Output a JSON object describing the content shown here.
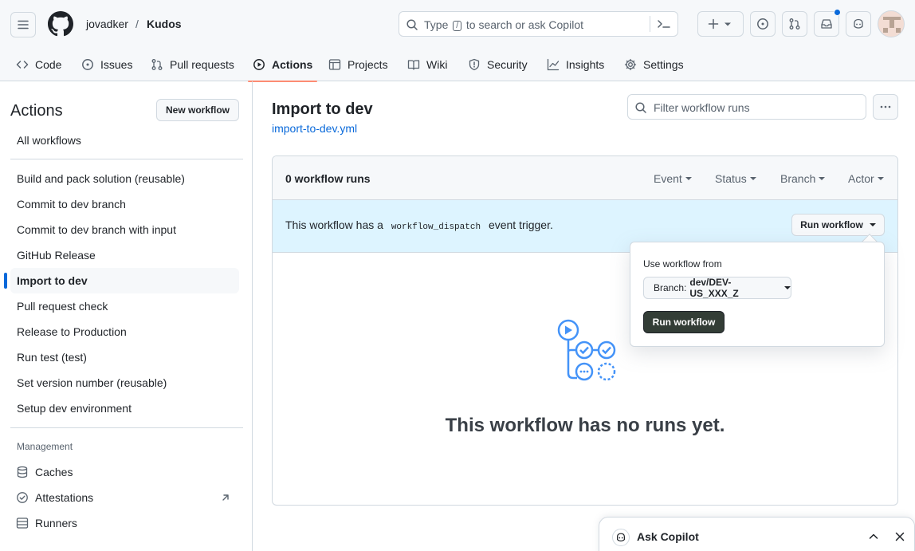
{
  "header": {
    "owner": "jovadker",
    "separator": "/",
    "repo": "Kudos",
    "search": {
      "prefix": "Type",
      "key": "/",
      "suffix": "to search or ask Copilot"
    },
    "plus_label": "+"
  },
  "tabs": [
    {
      "label": "Code",
      "icon": "code-icon"
    },
    {
      "label": "Issues",
      "icon": "issue-opened-icon"
    },
    {
      "label": "Pull requests",
      "icon": "git-pull-request-icon"
    },
    {
      "label": "Actions",
      "icon": "play-icon",
      "selected": true
    },
    {
      "label": "Projects",
      "icon": "table-icon"
    },
    {
      "label": "Wiki",
      "icon": "book-icon"
    },
    {
      "label": "Security",
      "icon": "shield-icon"
    },
    {
      "label": "Insights",
      "icon": "graph-icon"
    },
    {
      "label": "Settings",
      "icon": "gear-icon"
    }
  ],
  "sidebar": {
    "title": "Actions",
    "new_workflow": "New workflow",
    "all_workflows": "All workflows",
    "workflows": [
      "Build and pack solution (reusable)",
      "Commit to dev branch",
      "Commit to dev branch with input",
      "GitHub Release",
      "Import to dev",
      "Pull request check",
      "Release to Production",
      "Run test (test)",
      "Set version number (reusable)",
      "Setup dev environment"
    ],
    "active_index": 4,
    "management_heading": "Management",
    "management": [
      {
        "label": "Caches",
        "icon": "database-icon"
      },
      {
        "label": "Attestations",
        "icon": "verified-icon"
      },
      {
        "label": "Runners",
        "icon": "server-icon"
      }
    ]
  },
  "main": {
    "title": "Import to dev",
    "file": "import-to-dev.yml",
    "filter_placeholder": "Filter workflow runs",
    "runs_count": "0 workflow runs",
    "filters": [
      "Event",
      "Status",
      "Branch",
      "Actor"
    ],
    "dispatch_prefix": "This workflow has a",
    "dispatch_code": "workflow_dispatch",
    "dispatch_suffix": "event trigger.",
    "run_workflow": "Run workflow",
    "empty_text": "This workflow has no runs yet."
  },
  "popover": {
    "label": "Use workflow from",
    "branch_prefix": "Branch:",
    "branch_value": "dev/DEV-US_XXX_Z",
    "run_button": "Run workflow"
  },
  "copilot": {
    "label": "Ask Copilot"
  },
  "colors": {
    "accent": "#0969da",
    "selected_tab_underline": "#fd8c73",
    "dispatch_banner": "#ddf4ff",
    "run_button": "#333d36"
  }
}
